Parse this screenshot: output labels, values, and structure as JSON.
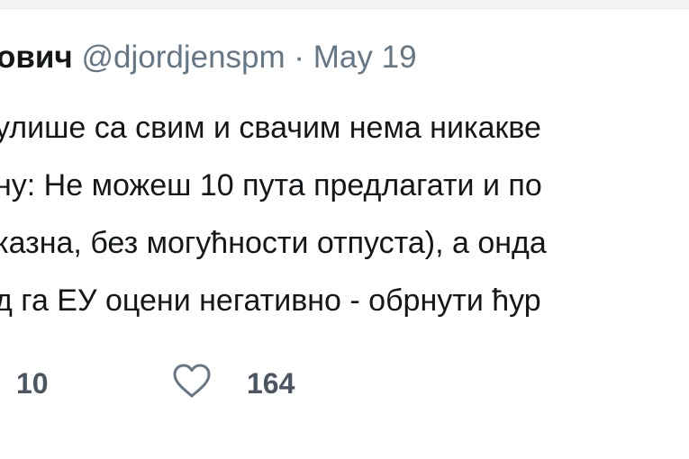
{
  "tweet": {
    "author_name": "ович",
    "handle": "@djordjenspm",
    "separator": "·",
    "date": "May 19",
    "lines": [
      "улише са свим и свачим нема никакве",
      "ну: Не можеш 10 пута предлагати и по",
      "казна, без могућности отпуста), а онда",
      "д га ЕУ оцени негативно - обрнути ћур"
    ],
    "retweet_count": "10",
    "like_count": "164"
  },
  "icons": {
    "like": "heart-outline-icon"
  },
  "colors": {
    "text": "#14171a",
    "secondary": "#657786",
    "counts": "#4b5662"
  }
}
